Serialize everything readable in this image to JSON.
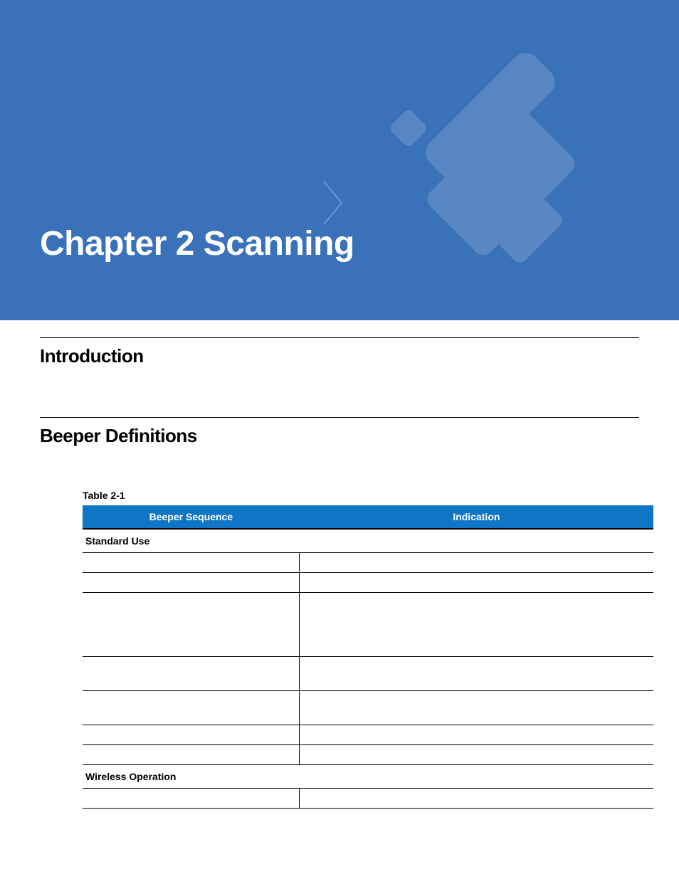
{
  "hero": {
    "title": "Chapter 2 Scanning"
  },
  "sections": {
    "intro": "Introduction",
    "beeper": "Beeper Definitions"
  },
  "table": {
    "label": "Table 2-1",
    "headers": {
      "col1": "Beeper Sequence",
      "col2": "Indication"
    },
    "subheads": {
      "standard": "Standard Use",
      "wireless": "Wireless Operation"
    }
  }
}
